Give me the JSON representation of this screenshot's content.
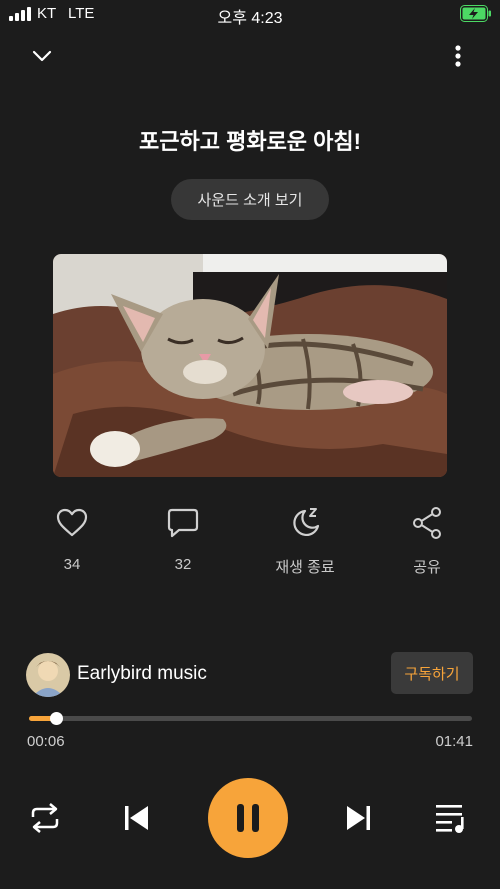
{
  "status": {
    "carrier": "KT",
    "network": "LTE",
    "time": "오후 4:23"
  },
  "header": {
    "collapse_icon": "chevron-down-icon",
    "menu_icon": "more-vertical-icon"
  },
  "title": "포근하고 평화로운 아침!",
  "intro_button": "사운드 소개 보기",
  "cover": {
    "subject": "sleeping-kitten-photo"
  },
  "actions": [
    {
      "icon": "heart-icon",
      "label": "34"
    },
    {
      "icon": "comment-icon",
      "label": "32"
    },
    {
      "icon": "moon-sleep-icon",
      "label": "재생 종료"
    },
    {
      "icon": "share-icon",
      "label": "공유"
    }
  ],
  "channel": {
    "name": "Earlybird music",
    "subscribe_label": "구독하기"
  },
  "player": {
    "elapsed": "00:06",
    "duration": "01:41",
    "progress": 0.06,
    "state": "playing"
  },
  "controls": [
    "repeat-icon",
    "previous-icon",
    "pause-icon",
    "next-icon",
    "playlist-icon"
  ],
  "colors": {
    "accent": "#f7a43a",
    "background": "#1c1c1c",
    "battery": "#4cd964"
  }
}
